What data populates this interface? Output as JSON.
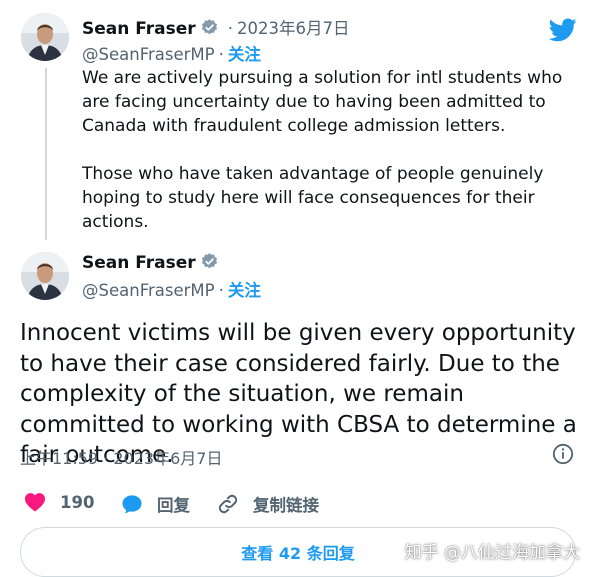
{
  "tweet1": {
    "author_name": "Sean Fraser",
    "date": "2023年6月7日",
    "handle": "@SeanFraserMP",
    "follow_label": "关注",
    "paragraphs": [
      "We are actively pursuing a solution for intl students who are facing uncertainty due to having been admitted to Canada with fraudulent college admission letters.",
      "Those who have taken advantage of people genuinely hoping to study here will face consequences for their actions."
    ]
  },
  "tweet2": {
    "author_name": "Sean Fraser",
    "handle": "@SeanFraserMP",
    "follow_label": "关注",
    "text": "Innocent victims will be given every opportunity to have their case considered fairly. Due to the complexity of the situation, we remain committed to working with CBSA to determine a fair outcome.",
    "timestamp": "上午11:59 · 2023年6月7日",
    "likes": "190",
    "reply_label": "回复",
    "copy_link_label": "复制链接",
    "view_replies_label": "查看 42 条回复"
  },
  "watermark": "知乎 @八仙过海加拿大",
  "colors": {
    "accent": "#1d9bf0",
    "like": "#f91880",
    "text": "#0f1419",
    "muted": "#536471"
  },
  "icons": [
    "twitter-bird-icon",
    "verified-badge-icon",
    "heart-icon",
    "reply-bubble-icon",
    "link-icon",
    "info-icon"
  ]
}
